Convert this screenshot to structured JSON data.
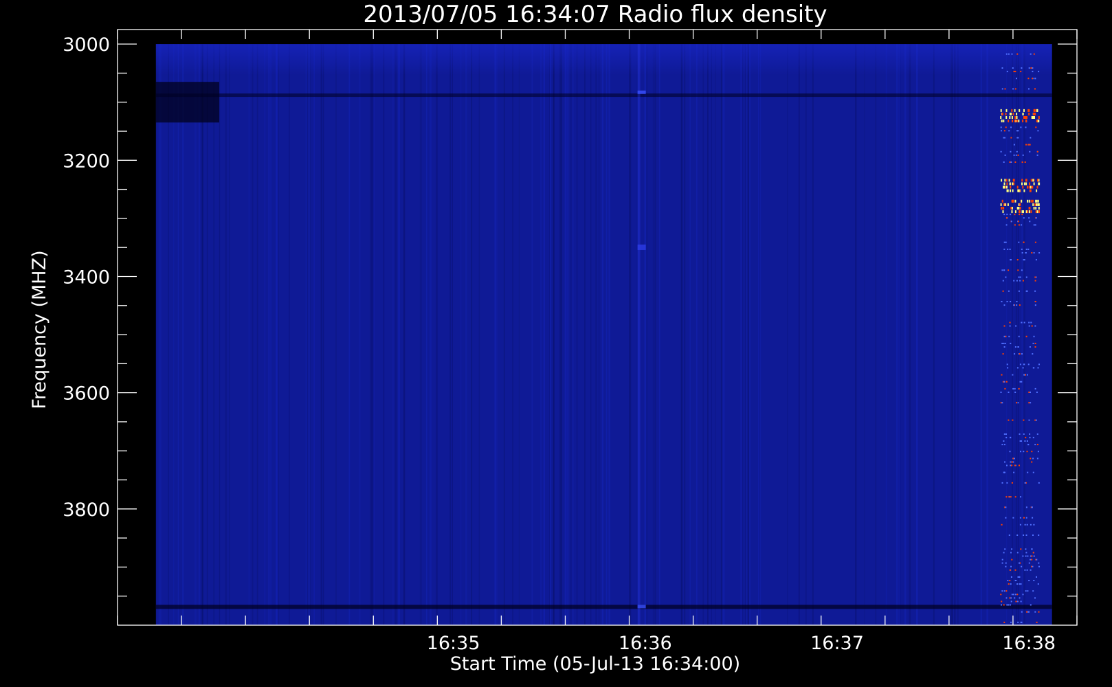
{
  "chart_data": {
    "type": "heatmap",
    "title": "2013/07/05 16:34:07 Radio flux density",
    "xlabel": "Start Time (05-Jul-13 16:34:00)",
    "ylabel": "Frequency (MHZ)",
    "x_tick_labels": [
      "16:35",
      "16:36",
      "16:37",
      "16:38"
    ],
    "x_tick_values_min": [
      35,
      36,
      37,
      38
    ],
    "x_range_min": [
      33.25,
      38.25
    ],
    "data_time_range_min": [
      33.45,
      38.12
    ],
    "y_tick_labels": [
      "3000",
      "3200",
      "3400",
      "3600",
      "3800"
    ],
    "y_tick_values": [
      3000,
      3200,
      3400,
      3600,
      3800
    ],
    "y_range_mhz": [
      2975,
      4000
    ],
    "y_axis": "inverted",
    "data_freq_range_mhz": [
      3000,
      4000
    ],
    "colormap": {
      "background": "#0f1a96",
      "low": "#000020",
      "mid": "#0a18b0",
      "high": "#ff4000",
      "peak": "#ffff80"
    },
    "burst": {
      "time_min": 37.95,
      "freq_mhz": [
        3010,
        3995
      ],
      "strongest_freq_mhz": [
        3120,
        3240,
        3275
      ]
    }
  }
}
